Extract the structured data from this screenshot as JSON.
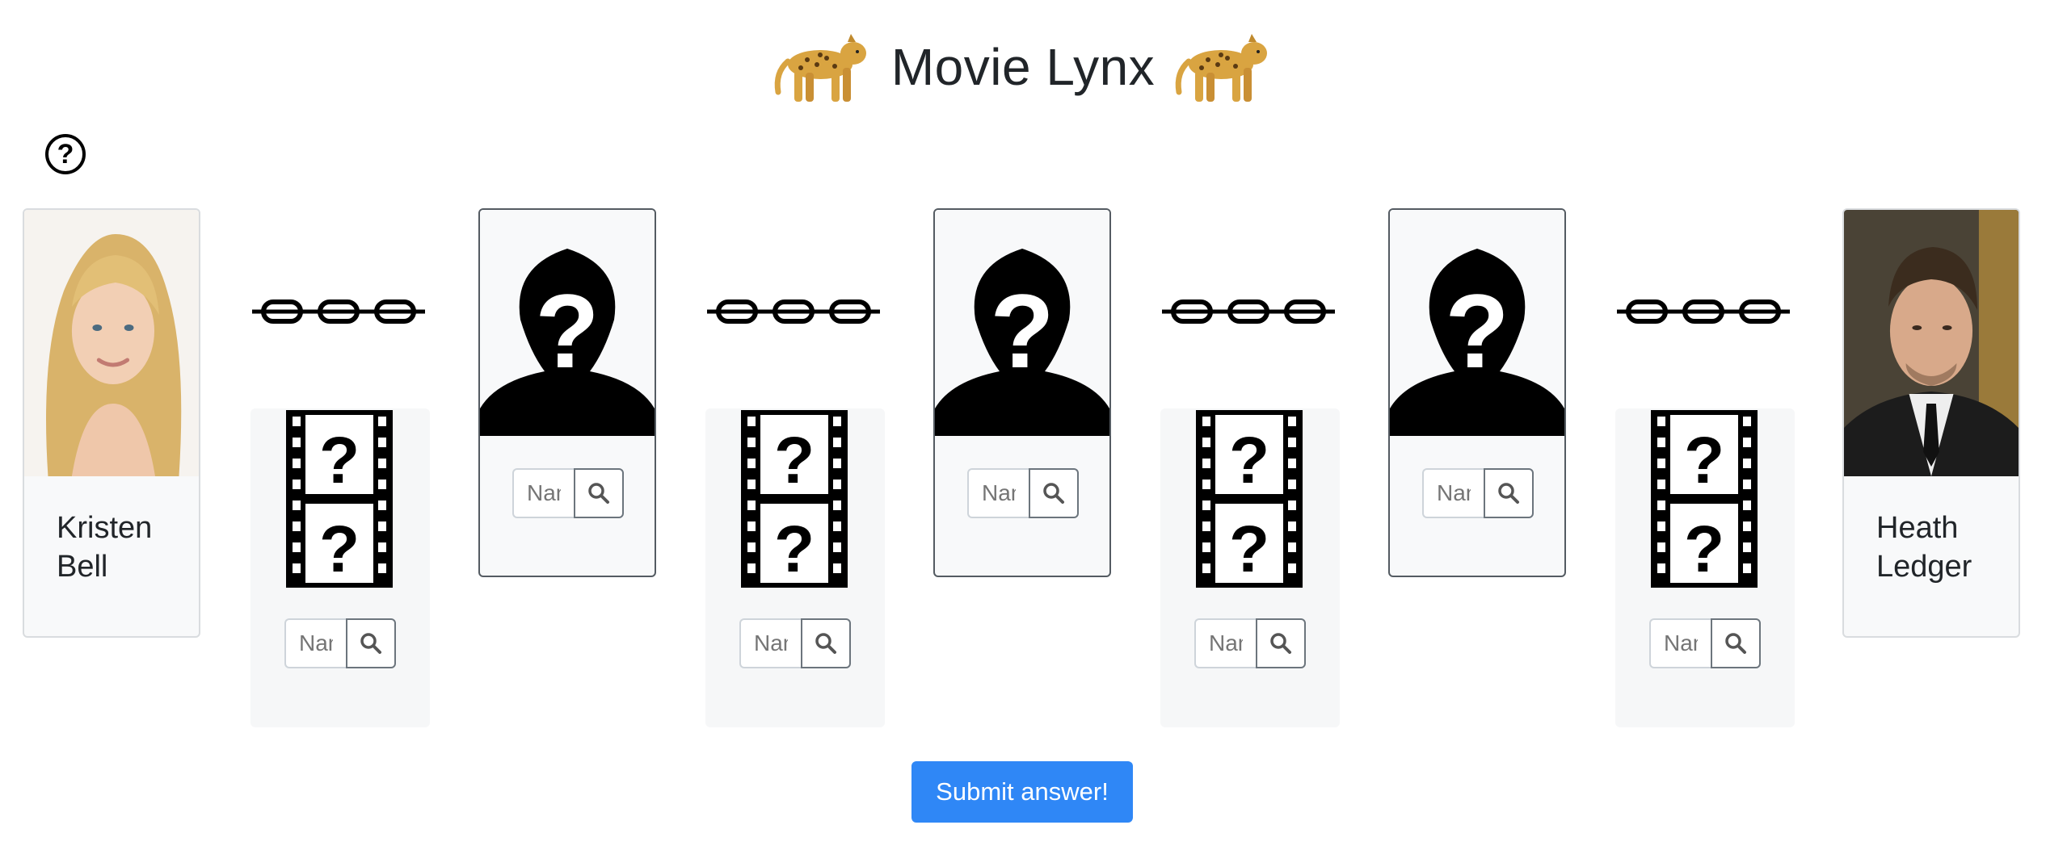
{
  "header": {
    "title": "Movie Lynx",
    "leopard_icon": "leopard-emoji"
  },
  "help": {
    "label": "?"
  },
  "start_actor": {
    "name": "Kristen Bell"
  },
  "end_actor": {
    "name": "Heath Ledger"
  },
  "actor_slots": [
    {
      "placeholder": "Name"
    },
    {
      "placeholder": "Name"
    },
    {
      "placeholder": "Name"
    }
  ],
  "movie_slots": [
    {
      "placeholder": "Name"
    },
    {
      "placeholder": "Name"
    },
    {
      "placeholder": "Name"
    },
    {
      "placeholder": "Name"
    }
  ],
  "submit": {
    "label": "Submit answer!"
  },
  "colors": {
    "primary": "#2f87f6",
    "card_bg": "#f8f9fa",
    "text": "#212529"
  }
}
